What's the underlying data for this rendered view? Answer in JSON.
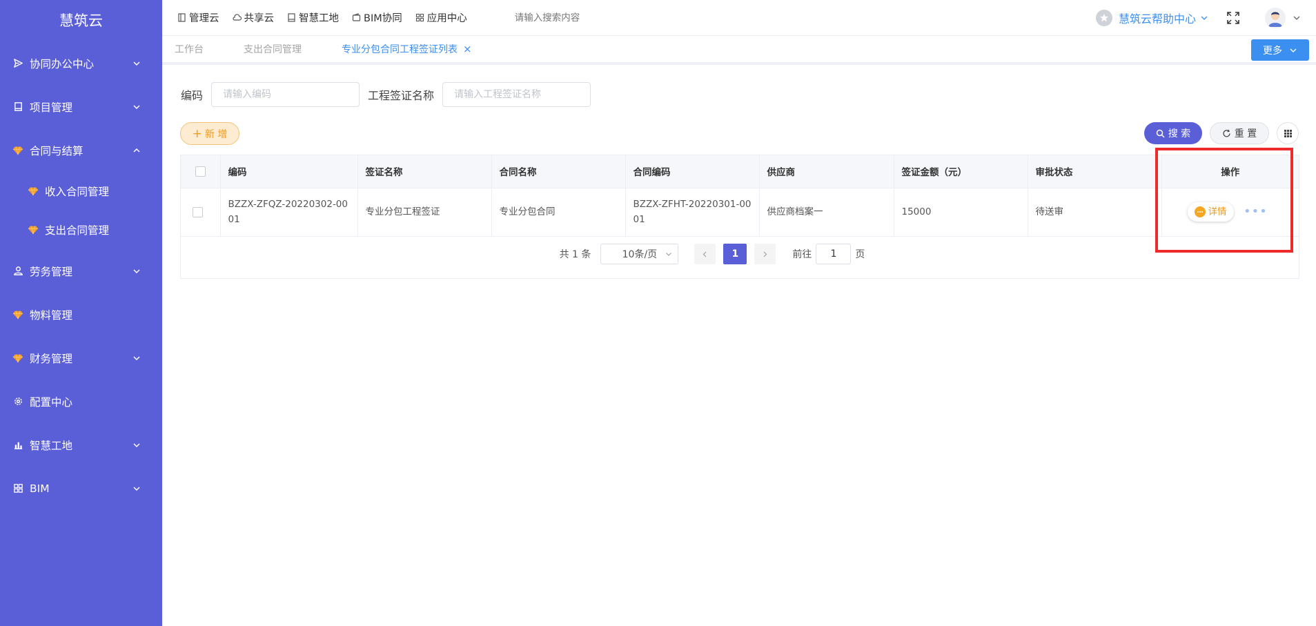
{
  "brand": "慧筑云",
  "sidebar": {
    "items": [
      {
        "label": "协同办公中心",
        "icon": "send-icon",
        "expandable": true
      },
      {
        "label": "项目管理",
        "icon": "book-icon",
        "expandable": true
      },
      {
        "label": "合同与结算",
        "icon": "gem-icon",
        "expandable": true,
        "expanded": true
      },
      {
        "label": "收入合同管理",
        "icon": "gem-icon",
        "sub": true
      },
      {
        "label": "支出合同管理",
        "icon": "gem-icon",
        "sub": true
      },
      {
        "label": "劳务管理",
        "icon": "user-icon",
        "expandable": true
      },
      {
        "label": "物料管理",
        "icon": "gem-icon"
      },
      {
        "label": "财务管理",
        "icon": "gem-icon",
        "expandable": true
      },
      {
        "label": "配置中心",
        "icon": "gear-icon"
      },
      {
        "label": "智慧工地",
        "icon": "bar-chart-icon",
        "expandable": true
      },
      {
        "label": "BIM",
        "icon": "grid-icon",
        "expandable": true
      }
    ]
  },
  "topnav": {
    "items": [
      "管理云",
      "共享云",
      "智慧工地",
      "BIM协同",
      "应用中心"
    ],
    "search_placeholder": "请输入搜索内容",
    "help_label": "慧筑云帮助中心"
  },
  "tabs": {
    "items": [
      "工作台",
      "支出合同管理",
      "专业分包合同工程签证列表"
    ],
    "close_symbol": "×",
    "more_label": "更多"
  },
  "filters": {
    "code_label": "编码",
    "code_placeholder": "请输入编码",
    "name_label": "工程签证名称",
    "name_placeholder": "请输入工程签证名称"
  },
  "toolbar": {
    "add_label": "新 增",
    "search_label": "搜 索",
    "reset_label": "重 置"
  },
  "table": {
    "headers": [
      "编码",
      "签证名称",
      "合同名称",
      "合同编码",
      "供应商",
      "签证金额（元）",
      "审批状态",
      "操作"
    ],
    "rows": [
      [
        "BZZX-ZFQZ-20220302-0001",
        "专业分包工程签证",
        "专业分包合同",
        "BZZX-ZFHT-20220301-0001",
        "供应商档案一",
        "15000",
        "待送审"
      ]
    ],
    "detail_label": "详情",
    "more_dots": "•••"
  },
  "pagination": {
    "total_text": "共 1 条",
    "page_size": "10条/页",
    "current_page": "1",
    "goto_prefix": "前往",
    "goto_value": "1",
    "goto_suffix": "页"
  },
  "colors": {
    "sidebar_bg": "#5a5fd8",
    "accent_blue": "#3b8ff0",
    "primary": "#5a5fd8",
    "warning": "#f09a1a",
    "highlight": "#ee2a2a"
  }
}
